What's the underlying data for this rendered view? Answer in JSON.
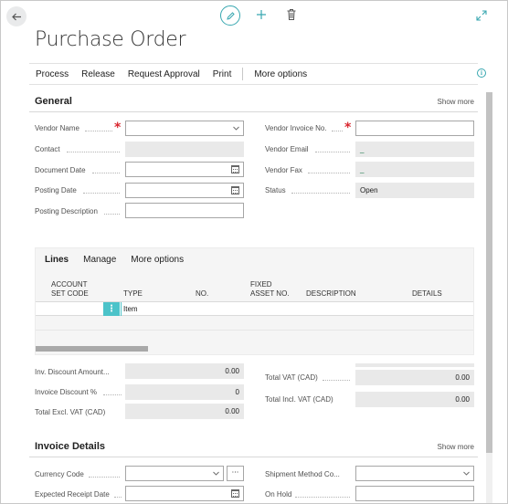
{
  "page": {
    "title": "Purchase Order"
  },
  "toolbar": {
    "icons": [
      "back-arrow-icon",
      "edit-pencil-icon",
      "plus-icon",
      "trash-icon",
      "expand-icon"
    ]
  },
  "actions": [
    "Process",
    "Release",
    "Request Approval",
    "Print",
    "More options"
  ],
  "general": {
    "header": "General",
    "show_more": "Show more",
    "vendor_name_label": "Vendor Name",
    "contact_label": "Contact",
    "document_date_label": "Document Date",
    "posting_date_label": "Posting Date",
    "posting_description_label": "Posting Description",
    "vendor_invoice_label": "Vendor Invoice No.",
    "vendor_email_label": "Vendor Email",
    "vendor_email_value": "_",
    "vendor_fax_label": "Vendor Fax",
    "vendor_fax_value": "_",
    "status_label": "Status",
    "status_value": "Open"
  },
  "lines": {
    "tab_lines": "Lines",
    "tab_manage": "Manage",
    "tab_more": "More options",
    "col_account_1": "ACCOUNT",
    "col_account_2": "SET CODE",
    "col_type": "TYPE",
    "col_no": "NO.",
    "col_fixed_1": "FIXED",
    "col_fixed_2": "ASSET NO.",
    "col_description": "DESCRIPTION",
    "col_details": "DETAILS",
    "row_menu": "⋮",
    "row_type": "Item"
  },
  "totals": {
    "inv_discount_amount_label": "Inv. Discount Amount...",
    "inv_discount_amount_value": "0.00",
    "invoice_discount_pct_label": "Invoice Discount %",
    "invoice_discount_pct_value": "0",
    "total_excl_vat_label": "Total Excl. VAT (CAD)",
    "total_excl_vat_value": "0.00",
    "total_vat_label": "Total VAT (CAD)",
    "total_vat_value": "0.00",
    "total_incl_vat_label": "Total Incl. VAT (CAD)",
    "total_incl_vat_value": "0.00"
  },
  "invoice_details": {
    "header": "Invoice Details",
    "show_more": "Show more",
    "currency_code_label": "Currency Code",
    "currency_ellipsis": "···",
    "expected_receipt_label": "Expected Receipt Date",
    "shipment_method_label": "Shipment Method Co...",
    "on_hold_label": "On Hold"
  },
  "colors": {
    "accent": "#38a7b0",
    "required": "#d9262e",
    "row_selected": "#4cc3c9"
  }
}
